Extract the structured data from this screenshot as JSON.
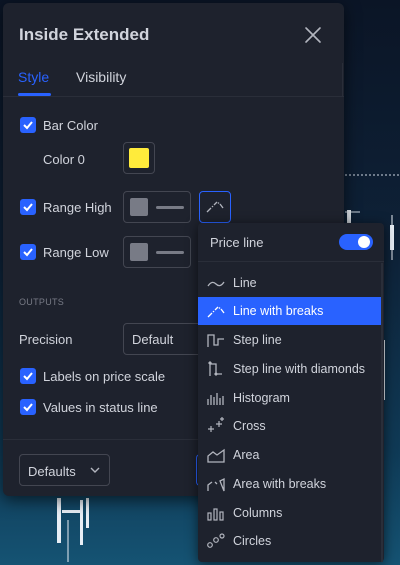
{
  "dialog": {
    "title": "Inside Extended",
    "tabs": [
      {
        "label": "Style",
        "active": true
      },
      {
        "label": "Visibility",
        "active": false
      }
    ]
  },
  "style": {
    "bar_color": {
      "label": "Bar Color",
      "checked": true
    },
    "color0": {
      "label": "Color 0",
      "color": "#ffeb3b"
    },
    "range_high": {
      "label": "Range High",
      "checked": true
    },
    "range_low": {
      "label": "Range Low",
      "checked": true
    },
    "outputs_header": "OUTPUTS",
    "precision": {
      "label": "Precision",
      "value": "Default"
    },
    "labels_on_price_scale": {
      "label": "Labels on price scale",
      "checked": true
    },
    "values_in_status_line": {
      "label": "Values in status line",
      "checked": true
    }
  },
  "footer": {
    "defaults_label": "Defaults"
  },
  "plot_menu": {
    "price_line": {
      "label": "Price line",
      "enabled": true
    },
    "items": [
      {
        "label": "Line",
        "icon": "line-icon",
        "selected": false
      },
      {
        "label": "Line with breaks",
        "icon": "line-with-breaks-icon",
        "selected": true
      },
      {
        "label": "Step line",
        "icon": "step-line-icon",
        "selected": false
      },
      {
        "label": "Step line with diamonds",
        "icon": "step-line-diamonds-icon",
        "selected": false
      },
      {
        "label": "Histogram",
        "icon": "histogram-icon",
        "selected": false
      },
      {
        "label": "Cross",
        "icon": "cross-icon",
        "selected": false
      },
      {
        "label": "Area",
        "icon": "area-icon",
        "selected": false
      },
      {
        "label": "Area with breaks",
        "icon": "area-with-breaks-icon",
        "selected": false
      },
      {
        "label": "Columns",
        "icon": "columns-icon",
        "selected": false
      },
      {
        "label": "Circles",
        "icon": "circles-icon",
        "selected": false
      }
    ]
  },
  "colors": {
    "accent": "#2962ff",
    "panel": "#1e222d",
    "text": "#d1d4dc"
  }
}
